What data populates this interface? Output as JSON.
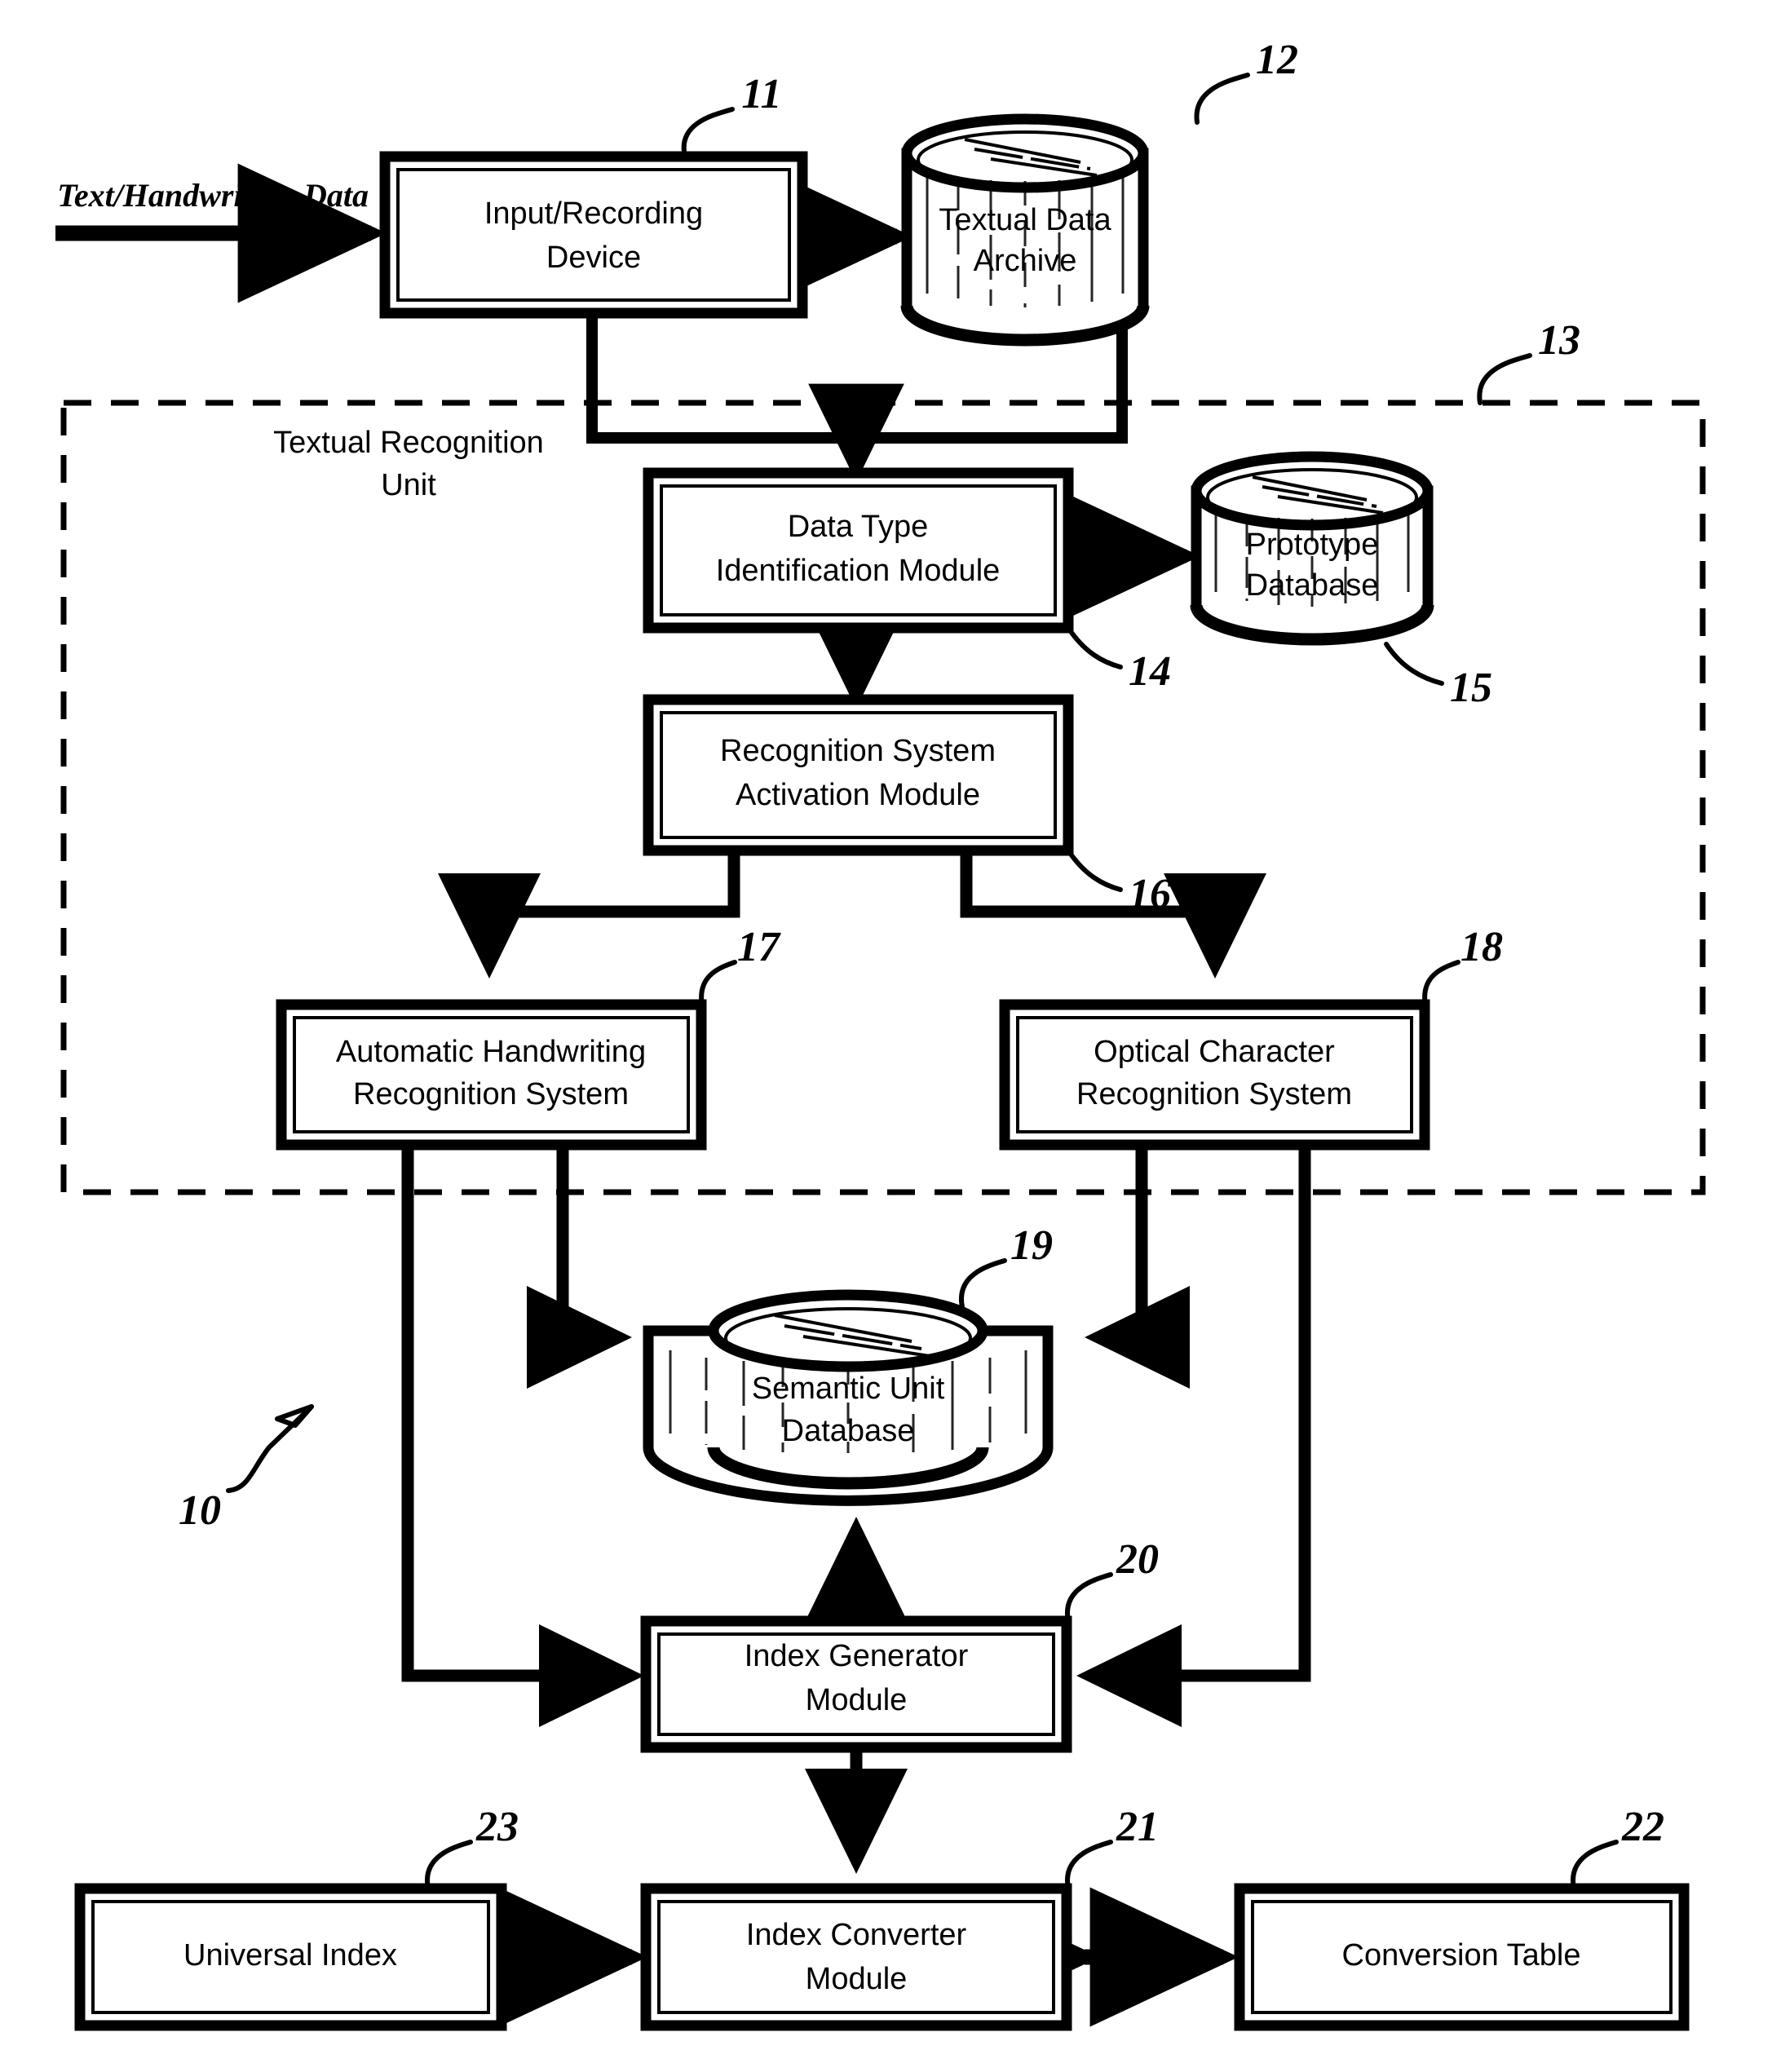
{
  "figure": {
    "input_label": "Text/Handwriting Data",
    "unit_label_line1": "Textual Recognition",
    "unit_label_line2": "Unit",
    "system_ref": "10"
  },
  "boxes": {
    "input_device": {
      "line1": "Input/Recording",
      "line2": "Device",
      "ref": "11"
    },
    "data_type": {
      "line1": "Data Type",
      "line2": "Identification Module",
      "ref": "14"
    },
    "activation": {
      "line1": "Recognition System",
      "line2": "Activation Module",
      "ref": "16"
    },
    "ahr": {
      "line1": "Automatic Handwriting",
      "line2": "Recognition System",
      "ref": "17"
    },
    "ocr": {
      "line1": "Optical Character",
      "line2": "Recognition System",
      "ref": "18"
    },
    "index_generator": {
      "line1": "Index Generator",
      "line2": "Module",
      "ref": "20"
    },
    "universal_index": {
      "line1": "Universal Index",
      "line2": "",
      "ref": "23"
    },
    "index_converter": {
      "line1": "Index Converter",
      "line2": "Module",
      "ref": "21"
    },
    "conversion_table": {
      "line1": "Conversion Table",
      "line2": "",
      "ref": "22"
    }
  },
  "cylinders": {
    "textual_archive": {
      "line1": "Textual  Data",
      "line2": "Archive",
      "ref": "12"
    },
    "prototype_db": {
      "line1": "Prototype",
      "line2": "Database",
      "ref": "15"
    },
    "semantic_db": {
      "line1": "Semantic Unit",
      "line2": "Database",
      "ref": "19"
    }
  },
  "dashed_region": {
    "ref": "13"
  },
  "colors": {
    "ink": "#000000",
    "paper": "#ffffff"
  }
}
